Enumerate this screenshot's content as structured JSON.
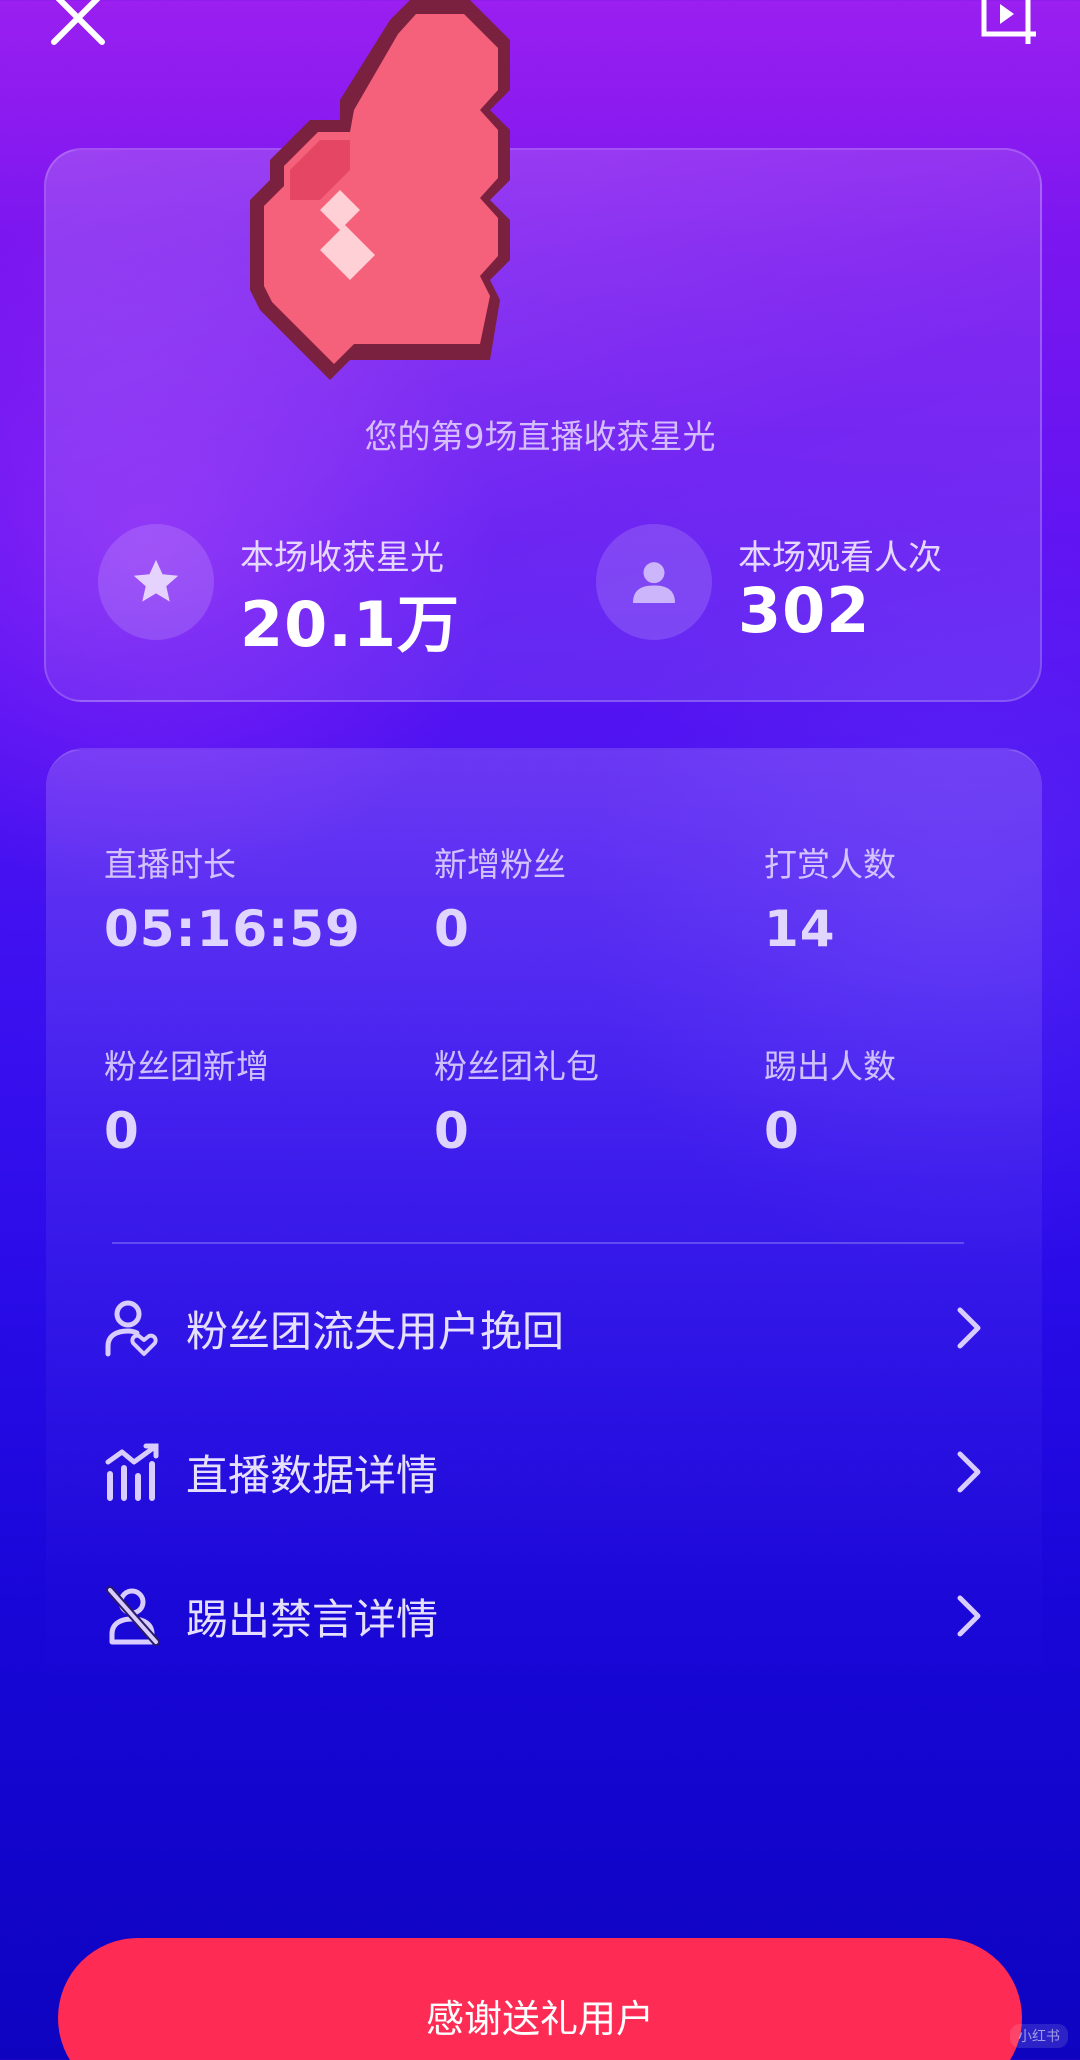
{
  "summary": {
    "subtitle": "您的第9场直播收获星光",
    "starlight": {
      "label": "本场收获星光",
      "value": "20.1万"
    },
    "viewers": {
      "label": "本场观看人次",
      "value": "302"
    }
  },
  "stats": [
    {
      "label": "直播时长",
      "value": "05:16:59"
    },
    {
      "label": "新增粉丝",
      "value": "0"
    },
    {
      "label": "打赏人数",
      "value": "14"
    },
    {
      "label": "粉丝团新增",
      "value": "0"
    },
    {
      "label": "粉丝团礼包",
      "value": "0"
    },
    {
      "label": "踢出人数",
      "value": "0"
    }
  ],
  "menu": [
    {
      "label": "粉丝团流失用户挽回",
      "icon": "user-heart-icon"
    },
    {
      "label": "直播数据详情",
      "icon": "bar-chart-icon"
    },
    {
      "label": "踢出禁言详情",
      "icon": "mute-icon"
    }
  ],
  "button": {
    "label": "感谢送礼用户"
  },
  "watermark": {
    "text": "小红书"
  },
  "colors": {
    "accent": "#fe2c55",
    "heart": "#f5607a",
    "heart_outline": "#7a2140"
  }
}
